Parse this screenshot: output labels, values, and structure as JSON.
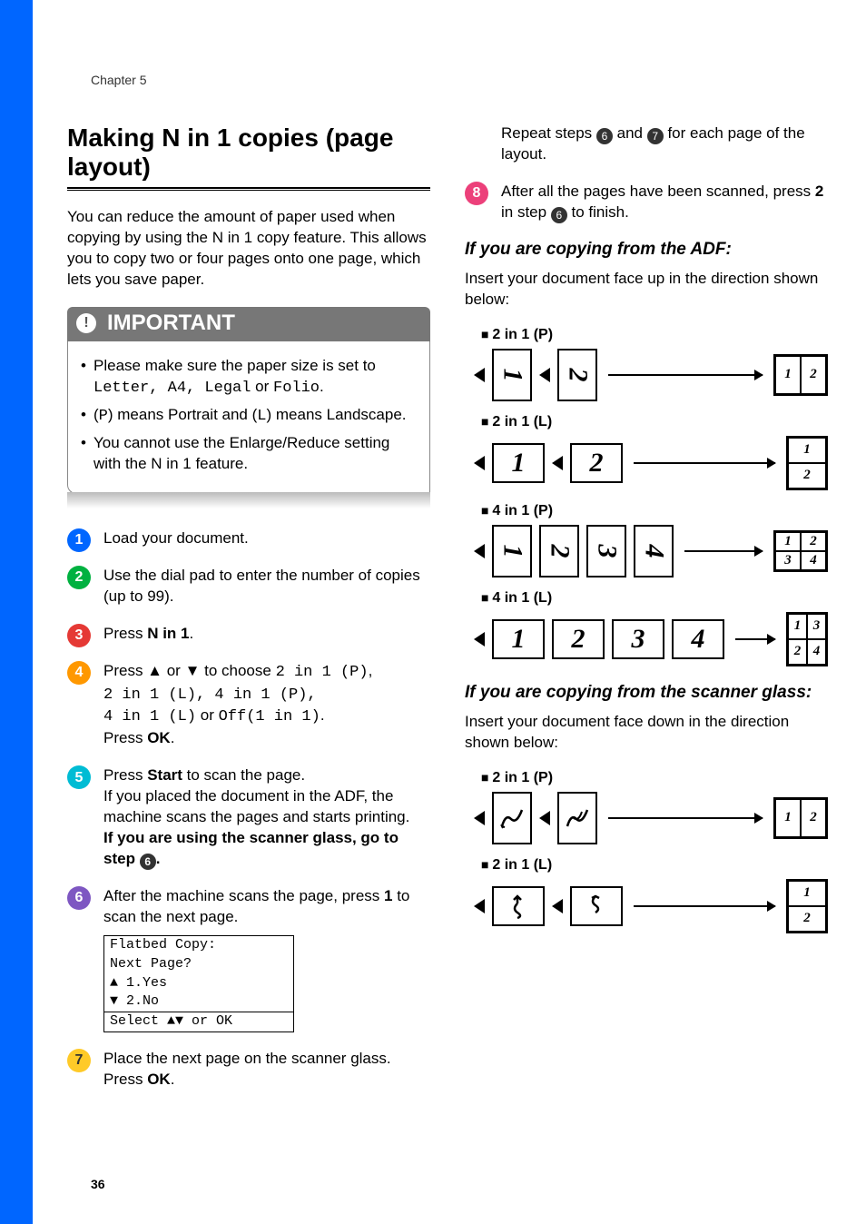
{
  "chapter": "Chapter 5",
  "page_number": "36",
  "heading": "Making N in 1 copies (page layout)",
  "intro": "You can reduce the amount of paper used when copying by using the N in 1 copy feature. This allows you to copy two or four pages onto one page, which lets you save paper.",
  "important": {
    "title": "IMPORTANT",
    "items": [
      {
        "pre": "Please make sure the paper size is set to ",
        "codes": "Letter, A4, Legal",
        "mid": " or ",
        "code2": "Folio",
        "post": "."
      },
      {
        "pre": "(",
        "c1": "P",
        "mid1": ") means Portrait and (",
        "c2": "L",
        "post": ") means Landscape."
      },
      {
        "text": "You cannot use the Enlarge/Reduce setting with the N in 1 feature."
      }
    ]
  },
  "steps_left": [
    {
      "n": "1",
      "cls": "c1",
      "text": "Load your document."
    },
    {
      "n": "2",
      "cls": "c2",
      "text": "Use the dial pad to enter the number of copies (up to 99)."
    },
    {
      "n": "3",
      "cls": "c3",
      "pre": "Press ",
      "bold": "N in 1",
      "post": "."
    },
    {
      "n": "4",
      "cls": "c4",
      "line1_pre": "Press ▲ or ▼ to choose ",
      "line1_code": "2 in 1 (P)",
      "line1_post": ",",
      "line2_code": "2 in 1 (L), 4 in 1 (P),",
      "line3_code1": "4 in 1 (L)",
      "line3_mid": " or ",
      "line3_code2": "Off(1 in 1)",
      "line3_post": ".",
      "line4_pre": "Press ",
      "line4_bold": "OK",
      "line4_post": "."
    },
    {
      "n": "5",
      "cls": "c5",
      "l1_pre": "Press ",
      "l1_bold": "Start",
      "l1_post": " to scan the page.",
      "l2": "If you placed the document in the ADF, the machine scans the pages and starts printing.",
      "l3_bold_pre": "If you are using the scanner glass, go to step ",
      "l3_badge": "6",
      "l3_bold_post": "."
    },
    {
      "n": "6",
      "cls": "c6",
      "l1": "After the machine scans the page, press ",
      "l1_bold": "1",
      "l1_post": " to scan the next page.",
      "lcd": [
        "Flatbed Copy:",
        " Next Page?",
        "▲ 1.Yes",
        "▼ 2.No",
        "Select ▲▼ or OK"
      ]
    },
    {
      "n": "7",
      "cls": "c7",
      "l1": "Place the next page on the scanner glass.",
      "l2_pre": "Press ",
      "l2_bold": "OK",
      "l2_post": "."
    }
  ],
  "right_top": {
    "repeat_pre": "Repeat steps ",
    "b1": "6",
    "mid": " and ",
    "b2": "7",
    "post": " for each page of the layout.",
    "step8_n": "8",
    "step8_cls": "c8",
    "step8_l1": "After all the pages have been scanned, press ",
    "step8_bold": "2",
    "step8_mid": " in step ",
    "step8_badge": "6",
    "step8_post": " to finish."
  },
  "adf": {
    "heading": "If you are copying from the ADF:",
    "intro": "Insert your document face up in the direction shown below:",
    "layouts": {
      "p21": "2 in 1 (P)",
      "l21": "2 in 1 (L)",
      "p41": "4 in 1 (P)",
      "l41": "4 in 1 (L)"
    }
  },
  "glass": {
    "heading": "If you are copying from the scanner glass:",
    "intro": "Insert your document face down in the direction shown below:",
    "layouts": {
      "p21": "2 in 1 (P)",
      "l21": "2 in 1 (L)"
    }
  },
  "chart_data": {
    "type": "table",
    "title": "N in 1 layout diagrams",
    "rows": [
      {
        "source": "ADF",
        "layout": "2 in 1 (P)",
        "inputs": [
          1,
          2
        ],
        "output_grid": [
          [
            1,
            2
          ]
        ]
      },
      {
        "source": "ADF",
        "layout": "2 in 1 (L)",
        "inputs": [
          1,
          2
        ],
        "output_grid": [
          [
            1
          ],
          [
            2
          ]
        ]
      },
      {
        "source": "ADF",
        "layout": "4 in 1 (P)",
        "inputs": [
          1,
          2,
          3,
          4
        ],
        "output_grid": [
          [
            1,
            2
          ],
          [
            3,
            4
          ]
        ]
      },
      {
        "source": "ADF",
        "layout": "4 in 1 (L)",
        "inputs": [
          1,
          2,
          3,
          4
        ],
        "output_grid": [
          [
            1,
            3
          ],
          [
            2,
            4
          ]
        ]
      },
      {
        "source": "Scanner glass",
        "layout": "2 in 1 (P)",
        "inputs": [
          1,
          2
        ],
        "output_grid": [
          [
            1,
            2
          ]
        ]
      },
      {
        "source": "Scanner glass",
        "layout": "2 in 1 (L)",
        "inputs": [
          1,
          2
        ],
        "output_grid": [
          [
            1
          ],
          [
            2
          ]
        ]
      }
    ]
  }
}
